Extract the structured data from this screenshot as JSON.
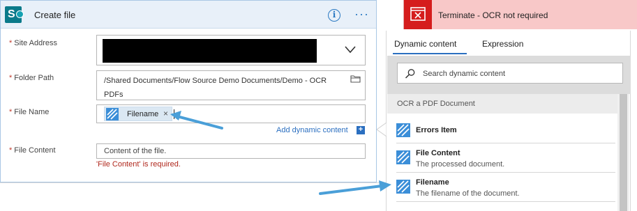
{
  "create_file": {
    "title": "Create file",
    "info_icon": "info-icon",
    "more_icon": "ellipsis-icon",
    "more_glyph": "···",
    "info_glyph": "i",
    "site_address": {
      "label": "Site Address",
      "required_mark": "*"
    },
    "folder_path": {
      "label": "Folder Path",
      "required_mark": "*",
      "value": "/Shared Documents/Flow Source Demo Documents/Demo - OCR PDFs"
    },
    "file_name": {
      "label": "File Name",
      "required_mark": "*",
      "token_label": "Filename",
      "token_close": "×"
    },
    "add_dynamic": {
      "label": "Add dynamic content",
      "icon": "+"
    },
    "file_content": {
      "label": "File Content",
      "required_mark": "*",
      "placeholder": "Content of the file.",
      "error": "'File Content' is required."
    }
  },
  "terminate": {
    "title": "Terminate - OCR not required"
  },
  "dynamic_panel": {
    "tabs": [
      {
        "label": "Dynamic content"
      },
      {
        "label": "Expression"
      }
    ],
    "search": {
      "placeholder": "Search dynamic content"
    },
    "section": "OCR a PDF Document",
    "items": [
      {
        "title": "Errors Item",
        "desc": ""
      },
      {
        "title": "File Content",
        "desc": "The processed document."
      },
      {
        "title": "Filename",
        "desc": "The filename of the document."
      }
    ]
  },
  "colors": {
    "accent": "#2b6fc0",
    "token_icon": "#3b8ed8",
    "terminate_bg": "#f8c8c8",
    "terminate_icon": "#d51d1d",
    "error_text": "#b0271c",
    "arrow": "#4a9fd8"
  }
}
